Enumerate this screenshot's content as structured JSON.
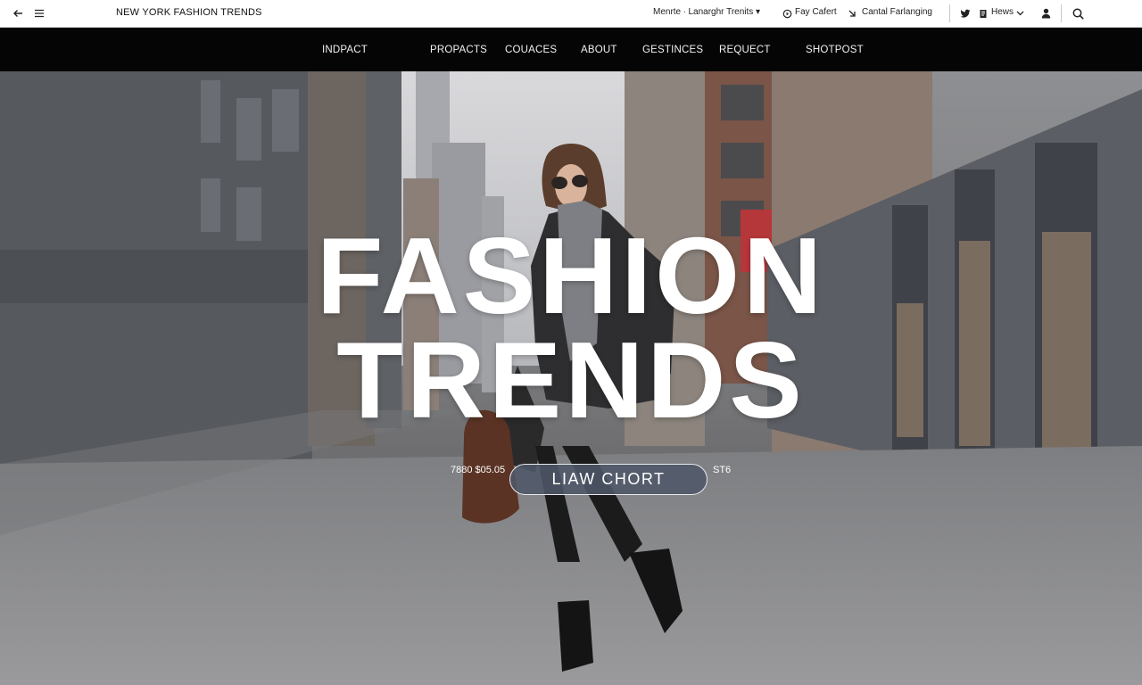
{
  "topbar": {
    "site_title": "NEW YORK FASHION TRENDS",
    "links": {
      "menu_link": "Menrte ∙ Lanarghr Trenits ▾",
      "play_link": "Fay Cafert",
      "cart_link": "Cantal Farlanging",
      "news_link": "Hews"
    }
  },
  "nav": {
    "items": [
      "INDPACT",
      "PROPACTS",
      "COUACES",
      "ABOUT",
      "GESTINCES",
      "REQUECT",
      "SHOTPOST"
    ]
  },
  "hero": {
    "line1": "FASHION",
    "line2": "TRENDS",
    "cta_label": "LIAW CHORT",
    "cta_left": "7880 $05.05",
    "cta_right": "ST6"
  },
  "colors": {
    "nav_bg": "#050505",
    "topbar_bg": "#ffffff",
    "cta_bg": "#4e5668",
    "hero_text": "#ffffff"
  },
  "icons": [
    "back-arrow-icon",
    "hamburger-menu-icon",
    "play-pin-icon",
    "cart-arrow-icon",
    "twitter-icon",
    "news-icon",
    "chevron-down-icon",
    "user-icon",
    "search-icon"
  ]
}
